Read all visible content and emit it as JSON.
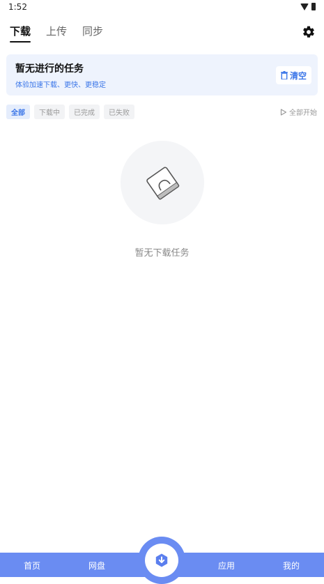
{
  "status_bar": {
    "time": "1:52",
    "icons": [
      "wifi-icon",
      "battery-icon"
    ]
  },
  "top_tabs": [
    {
      "label": "下载",
      "active": true
    },
    {
      "label": "上传",
      "active": false
    },
    {
      "label": "同步",
      "active": false
    }
  ],
  "settings_icon": "gear-icon",
  "info_card": {
    "title": "暂无进行的任务",
    "subtitle": "体验加速下载、更快、更稳定",
    "clear_label": "清空",
    "clear_icon": "trash-icon"
  },
  "filters": [
    {
      "label": "全部",
      "active": true
    },
    {
      "label": "下载中",
      "active": false
    },
    {
      "label": "已完成",
      "active": false
    },
    {
      "label": "已失败",
      "active": false
    }
  ],
  "start_all_label": "全部开始",
  "empty_state": {
    "icon": "empty-file-icon",
    "text": "暂无下载任务"
  },
  "bottom_nav": {
    "items": [
      {
        "label": "首页"
      },
      {
        "label": "网盘"
      },
      {
        "label": "应用"
      },
      {
        "label": "我的"
      }
    ],
    "center_icon": "download-icon"
  },
  "colors": {
    "accent": "#3b76e8",
    "nav_bg": "#6a8cf2",
    "card_bg": "#eef3fd"
  }
}
